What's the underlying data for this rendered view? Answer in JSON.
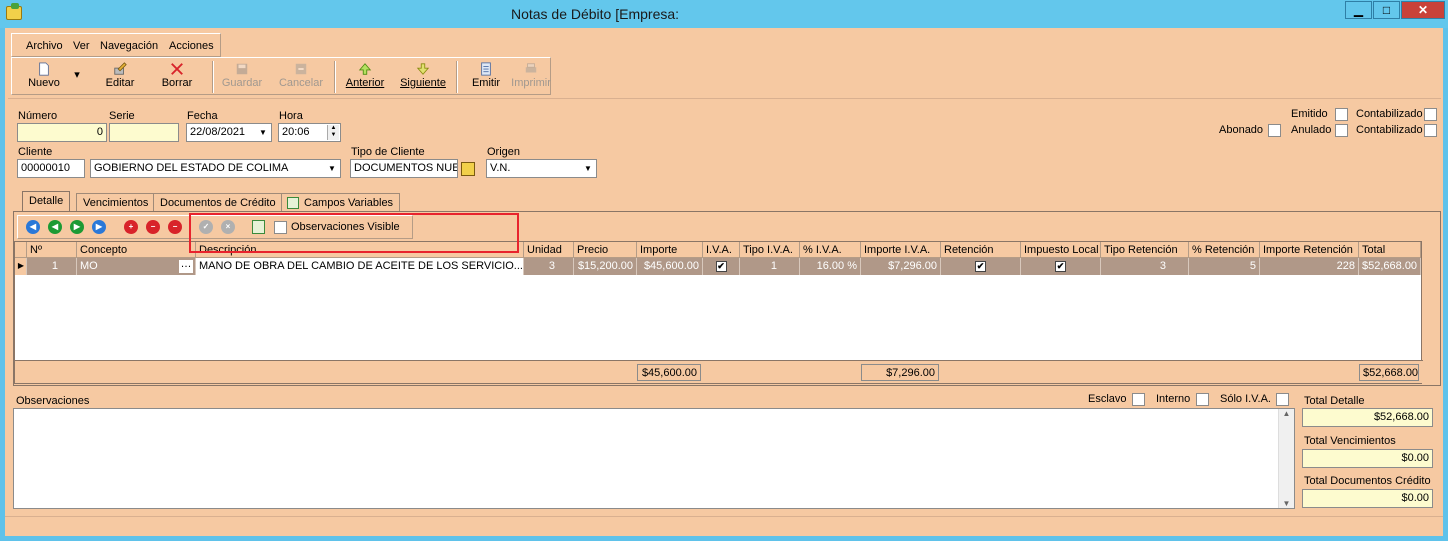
{
  "window": {
    "title": "Notas de Débito [Empresa:",
    "min_label": "▁",
    "max_label": "□",
    "close_label": "✕"
  },
  "menu": [
    "Archivo",
    "Ver",
    "Navegación",
    "Acciones"
  ],
  "toolbar": {
    "nuevo": "Nuevo",
    "editar": "Editar",
    "borrar": "Borrar",
    "guardar": "Guardar",
    "cancelar": "Cancelar",
    "anterior": "Anterior",
    "siguiente": "Siguiente",
    "emitir": "Emitir",
    "imprimir": "Imprimir"
  },
  "form": {
    "numero_label": "Número",
    "numero": "0",
    "serie_label": "Serie",
    "serie": "",
    "fecha_label": "Fecha",
    "fecha": "22/08/2021",
    "hora_label": "Hora",
    "hora": "20:06",
    "cliente_label": "Cliente",
    "cliente_codigo": "00000010",
    "cliente_nombre": "GOBIERNO DEL ESTADO DE COLIMA",
    "tipo_cliente_label": "Tipo de Cliente",
    "tipo_cliente": "DOCUMENTOS NUEV",
    "origen_label": "Origen",
    "origen": "V.N.",
    "emitido_label": "Emitido",
    "contabilizado_label": "Contabilizado",
    "abonado_label": "Abonado",
    "anulado_label": "Anulado",
    "contabilizado2_label": "Contabilizado"
  },
  "tabs": [
    "Detalle",
    "Vencimientos",
    "Documentos de Crédito",
    "Campos Variables"
  ],
  "grid_toolbar": {
    "observaciones_visible": "Observaciones Visible"
  },
  "grid": {
    "headers": [
      "Nº",
      "Concepto",
      "Descripción",
      "Unidad",
      "Precio",
      "Importe",
      "I.V.A.",
      "Tipo I.V.A.",
      "% I.V.A.",
      "Importe I.V.A.",
      "Retención",
      "Impuesto Local",
      "Tipo Retención",
      "% Retención",
      "Importe Retención",
      "Total"
    ],
    "row": {
      "no": "1",
      "concepto": "MO",
      "descripcion": "MANO DE OBRA DEL CAMBIO DE ACEITE DE LOS SERVICIO...",
      "unidad": "3",
      "precio": "$15,200.00",
      "importe": "$45,600.00",
      "iva_checked": "✔",
      "tipo_iva": "1",
      "pct_iva": "16.00 %",
      "importe_iva": "$7,296.00",
      "retencion_checked": "✔",
      "impuesto_local_checked": "✔",
      "tipo_retencion": "3",
      "pct_retencion": "5",
      "importe_retencion": "228",
      "total": "$52,668.00"
    },
    "footer": {
      "importe": "$45,600.00",
      "importe_iva": "$7,296.00",
      "total": "$52,668.00"
    }
  },
  "bottom": {
    "observaciones_label": "Observaciones",
    "esclavo_label": "Esclavo",
    "interno_label": "Interno",
    "solo_iva_label": "Sólo I.V.A.",
    "total_detalle_label": "Total Detalle",
    "total_detalle": "$52,668.00",
    "total_vencimientos_label": "Total Vencimientos",
    "total_vencimientos": "$0.00",
    "total_doc_credito_label": "Total Documentos Crédito",
    "total_doc_credito": "$0.00"
  }
}
